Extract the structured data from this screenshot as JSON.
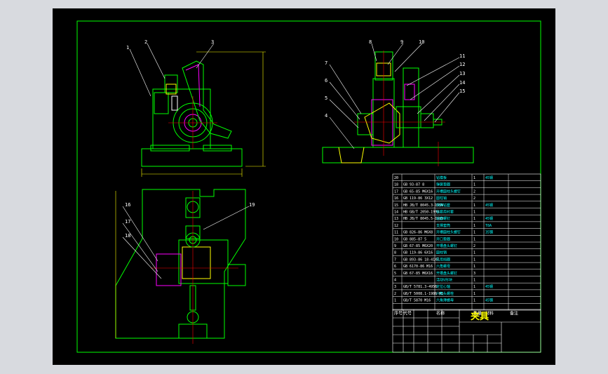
{
  "title_block": {
    "title": "夹具"
  },
  "balloons": {
    "top_left": [
      "1",
      "2",
      "3"
    ],
    "top_right": [
      "8",
      "9",
      "10",
      "11",
      "12",
      "13",
      "14",
      "15",
      "7",
      "6",
      "5",
      "4"
    ],
    "bottom": [
      "16",
      "17",
      "18",
      "19"
    ]
  },
  "bom": {
    "header": [
      "序号",
      "代号",
      "名称",
      "数量",
      "材料",
      "备注"
    ],
    "rows": [
      {
        "no": "20",
        "code": "",
        "name": "钻模板",
        "qty": "1",
        "mat": "45钢",
        "note": ""
      },
      {
        "no": "18",
        "code": "GB 93-87 8",
        "name": "弹簧垫圈",
        "qty": "1",
        "mat": "",
        "note": ""
      },
      {
        "no": "17",
        "code": "GB 65-85 M6X16",
        "name": "开槽圆柱头螺钉",
        "qty": "2",
        "mat": "",
        "note": ""
      },
      {
        "no": "16",
        "code": "GB 119-86 3X12",
        "name": "圆柱销",
        "qty": "2",
        "mat": "",
        "note": ""
      },
      {
        "no": "15",
        "code": "HB JB/T 8045.3-1999",
        "name": "快换钻套",
        "qty": "1",
        "mat": "45钢",
        "note": ""
      },
      {
        "no": "14",
        "code": "HB GB/T 2050-1999",
        "name": "钻套用衬套",
        "qty": "1",
        "mat": "",
        "note": ""
      },
      {
        "no": "13",
        "code": "HB JB/T 8045.5-1999",
        "name": "钻套螺钉",
        "qty": "1",
        "mat": "45钢",
        "note": ""
      },
      {
        "no": "12",
        "code": "",
        "name": "支撑套筒",
        "qty": "1",
        "mat": "T8A",
        "note": ""
      },
      {
        "no": "11",
        "code": "GB 826-86 M6X8",
        "name": "开槽圆柱头螺钉",
        "qty": "1",
        "mat": "35钢",
        "note": ""
      },
      {
        "no": "10",
        "code": "GB 885-87 5",
        "name": "开口垫圈",
        "qty": "1",
        "mat": "",
        "note": ""
      },
      {
        "no": "9",
        "code": "GB 67-85 M6X20",
        "name": "开槽盘头螺钉",
        "qty": "2",
        "mat": "",
        "note": ""
      },
      {
        "no": "8",
        "code": "GB 119-86 6X16",
        "name": "圆柱销",
        "qty": "1",
        "mat": "",
        "note": ""
      },
      {
        "no": "7",
        "code": "GB 893-86 18-41X7",
        "name": "孔用挡圈",
        "qty": "1",
        "mat": "",
        "note": ""
      },
      {
        "no": "6",
        "code": "GB 6170-86 M16",
        "name": "六角螺母",
        "qty": "1",
        "mat": "",
        "note": ""
      },
      {
        "no": "5",
        "code": "GB 67-85 M6X16",
        "name": "开槽盘头螺钉",
        "qty": "3",
        "mat": "",
        "note": ""
      },
      {
        "no": "4",
        "code": "",
        "name": "活动V形块",
        "qty": "1",
        "mat": "",
        "note": ""
      },
      {
        "no": "3",
        "code": "GB/T 5781.3-4956",
        "name": "定位心轴",
        "qty": "1",
        "mat": "45钢",
        "note": ""
      },
      {
        "no": "2",
        "code": "GB/T 5008.1-1986 M6",
        "name": "六角头螺栓",
        "qty": "1",
        "mat": "",
        "note": ""
      },
      {
        "no": "1",
        "code": "GB/T 5870 M16",
        "name": "六角薄螺母",
        "qty": "1",
        "mat": "45钢",
        "note": ""
      }
    ]
  },
  "colors": {
    "sheet": "#000000",
    "frame": "#00ff00",
    "part": "#00ff00",
    "accent": "#ff00ff",
    "dim": "#ffff00",
    "center": "#ff0000",
    "table": "#ffffff"
  }
}
